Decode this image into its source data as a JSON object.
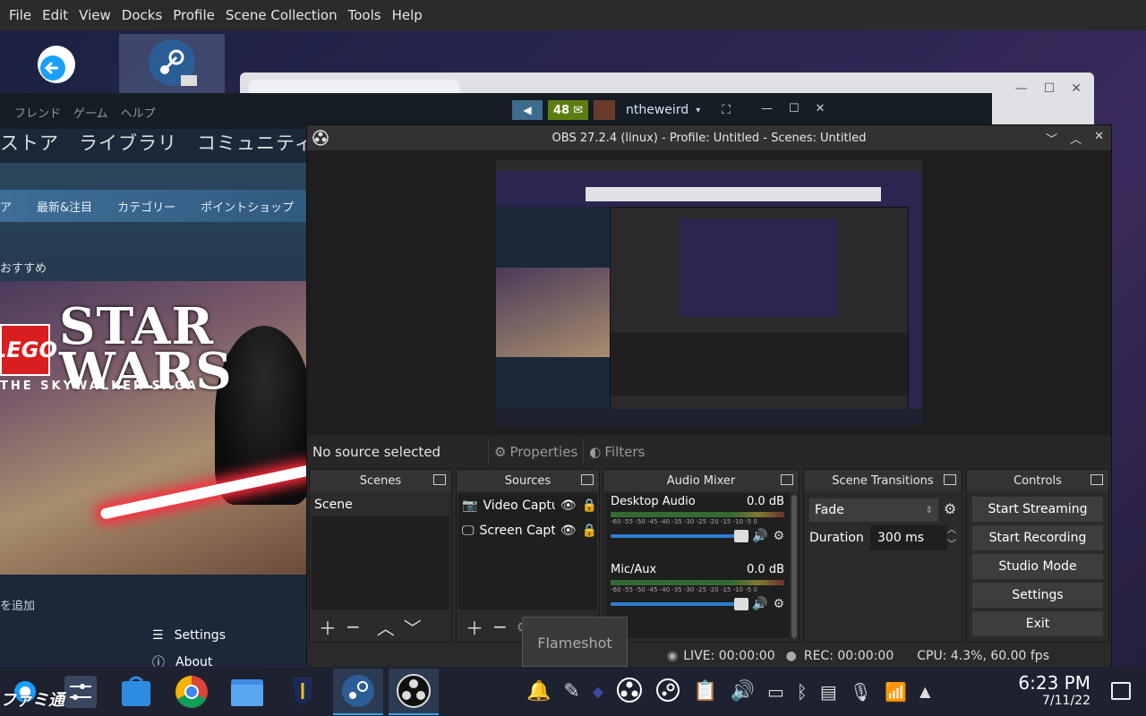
{
  "menubar": [
    "File",
    "Edit",
    "View",
    "Docks",
    "Profile",
    "Scene Collection",
    "Tools",
    "Help"
  ],
  "steam": {
    "menu": [
      "フレンド",
      "ゲーム",
      "ヘルプ"
    ],
    "messages_count": "48",
    "username": "ntheweird",
    "nav": [
      "ストア",
      "ライブラリ",
      "コミュニティ"
    ],
    "storebar": [
      "ア",
      "最新&注目",
      "カテゴリー",
      "ポイントショップ"
    ],
    "recommended": "おすすめ",
    "banner": {
      "lego": "LEGO",
      "title_line1": "STAR",
      "title_line2": "WARS",
      "subtitle": "THE SKYWALKER SAGA"
    },
    "add_game": "を追加",
    "context_menu": [
      "Settings",
      "About"
    ]
  },
  "obs": {
    "title": "OBS 27.2.4 (linux) - Profile: Untitled - Scenes: Untitled",
    "no_source": "No source selected",
    "properties_label": "Properties",
    "filters_label": "Filters",
    "scenes": {
      "title": "Scenes",
      "items": [
        "Scene"
      ]
    },
    "sources": {
      "title": "Sources",
      "items": [
        "Video Captu",
        "Screen Captu"
      ]
    },
    "mixer": {
      "title": "Audio Mixer",
      "scale": "-60 -55 -50 -45 -40 -35 -30 -25 -20 -15 -10 -5 0",
      "channels": [
        {
          "name": "Desktop Audio",
          "level": "0.0 dB",
          "volume": 1.0
        },
        {
          "name": "Mic/Aux",
          "level": "0.0 dB",
          "volume": 1.0
        }
      ]
    },
    "transitions": {
      "title": "Scene Transitions",
      "selected": "Fade",
      "duration_label": "Duration",
      "duration_value": "300 ms"
    },
    "controls": {
      "title": "Controls",
      "buttons": [
        "Start Streaming",
        "Start Recording",
        "Studio Mode",
        "Settings",
        "Exit"
      ]
    },
    "status": {
      "live": "LIVE: 00:00:00",
      "rec": "REC: 00:00:00",
      "cpu": "CPU: 4.3%, 60.00 fps"
    }
  },
  "tooltip": "Flameshot",
  "taskbar": {
    "time": "6:23 PM",
    "date": "7/11/22"
  },
  "watermark": "ファミ通"
}
